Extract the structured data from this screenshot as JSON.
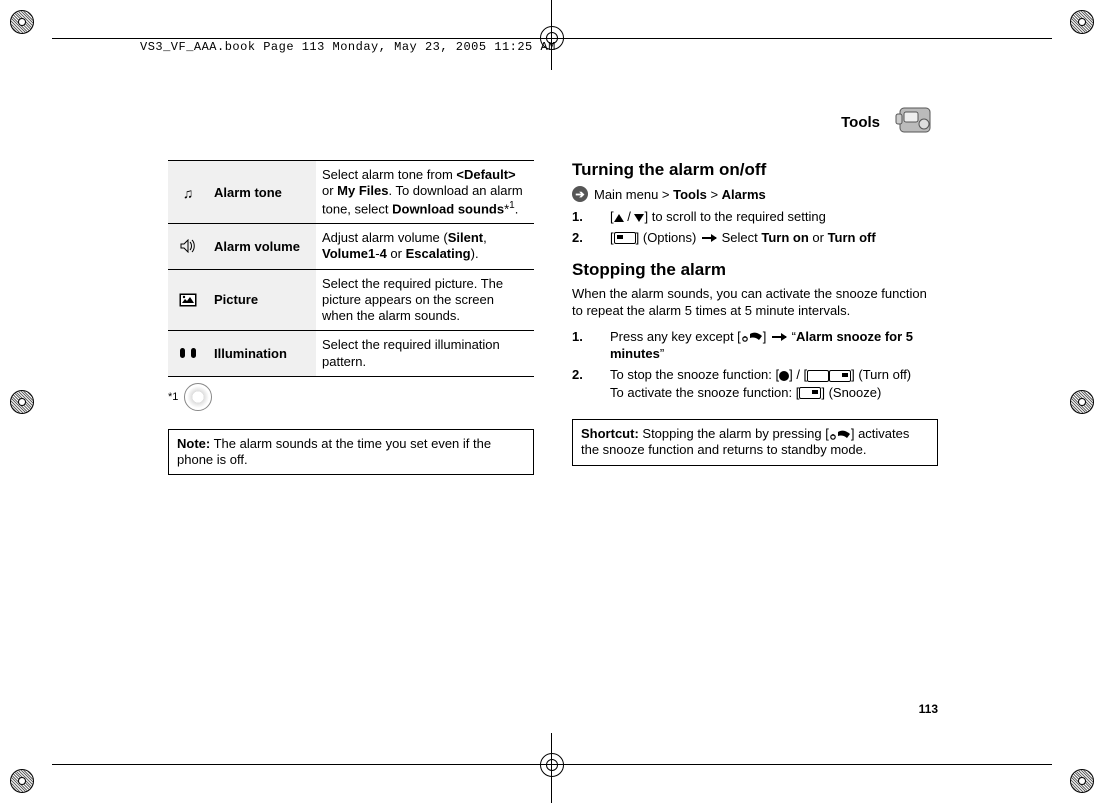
{
  "meta": {
    "header": "VS3_VF_AAA.book  Page 113  Monday, May 23, 2005  11:25 AM",
    "section_title": "Tools",
    "page_number": "113"
  },
  "table": {
    "rows": [
      {
        "label": "Alarm tone",
        "desc_parts": [
          "Select alarm tone from ",
          "<Default>",
          " or ",
          "My Files",
          ". To download an alarm tone, select ",
          "Download sounds",
          "*",
          "1",
          "."
        ]
      },
      {
        "label": "Alarm volume",
        "desc_parts": [
          "Adjust alarm volume (",
          "Silent",
          ", ",
          "Volume1",
          "-",
          "4",
          " or ",
          "Escalating",
          ")."
        ]
      },
      {
        "label": "Picture",
        "desc_plain": "Select the required picture. The picture appears on the screen when the alarm sounds."
      },
      {
        "label": "Illumination",
        "desc_plain": "Select the required illumination pattern."
      }
    ],
    "footnote_marker": "*1"
  },
  "note": {
    "label": "Note:",
    "text": " The alarm sounds at the time you set even if the phone is off."
  },
  "right": {
    "h1": "Turning the alarm on/off",
    "breadcrumb": [
      "Main menu > ",
      "Tools",
      " > ",
      "Alarms"
    ],
    "steps1": [
      "to scroll to the required setting",
      "(Options)  Select Turn on or Turn off"
    ],
    "turn_on": "Turn on",
    "turn_off": "Turn off",
    "options_label": "(Options)",
    "select_word": "Select",
    "h2": "Stopping the alarm",
    "h2_sub": "When the alarm sounds, you can activate the snooze function to repeat the alarm 5 times at 5 minute intervals.",
    "steps2": {
      "s1_pre": "Press any key except [",
      "s1_post": "] ",
      "s1_quote_open": "“",
      "s1_bold": "Alarm snooze for 5 minutes",
      "s1_quote_close": "”",
      "s2_pre": "To stop the snooze function: [",
      "s2_mid": "] / [",
      "s2_post": "] (Turn off)",
      "s2b_pre": "To activate the snooze function: [",
      "s2b_post": "] (Snooze)"
    },
    "shortcut": {
      "label": "Shortcut:",
      "pre": " Stopping the alarm by pressing [",
      "post": "] activates the snooze function and returns to standby mode."
    }
  }
}
